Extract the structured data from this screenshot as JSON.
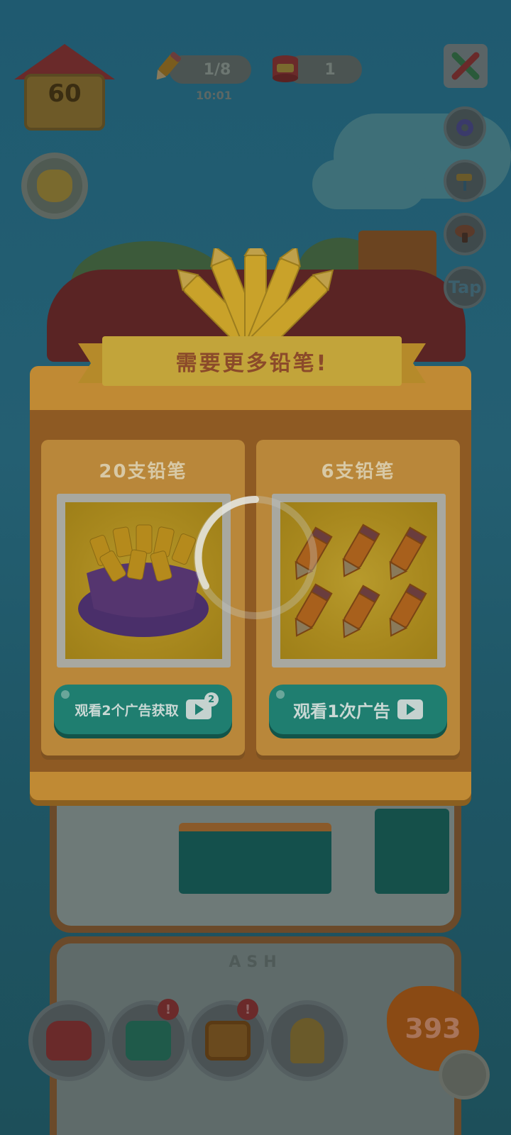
{
  "hud": {
    "house_level": "60",
    "pencils": {
      "count": "1/8",
      "timer": "10:01"
    },
    "paint_cans": {
      "count": "1"
    }
  },
  "side_buttons": [
    {
      "icon": "gear-icon"
    },
    {
      "icon": "paint-roller-icon"
    },
    {
      "icon": "mushroom-icon"
    },
    {
      "label": "Tap"
    }
  ],
  "dialog": {
    "title": "需要更多铅笔!",
    "offers": [
      {
        "title": "20支铅笔",
        "button": "观看2个广告获取",
        "ad_count": "2",
        "image": "pencil-sack"
      },
      {
        "title": "6支铅笔",
        "button": "观看1次广告",
        "image": "six-pencils"
      }
    ]
  },
  "scene": {
    "room_name": "ASH"
  },
  "bottom_bar": {
    "buttons": [
      {
        "icon": "armchair-icon",
        "alert": ""
      },
      {
        "icon": "book-icon",
        "alert": "!"
      },
      {
        "icon": "picture-frame-icon",
        "alert": "!"
      },
      {
        "icon": "lamp-icon",
        "alert": ""
      }
    ],
    "coins": "393"
  }
}
